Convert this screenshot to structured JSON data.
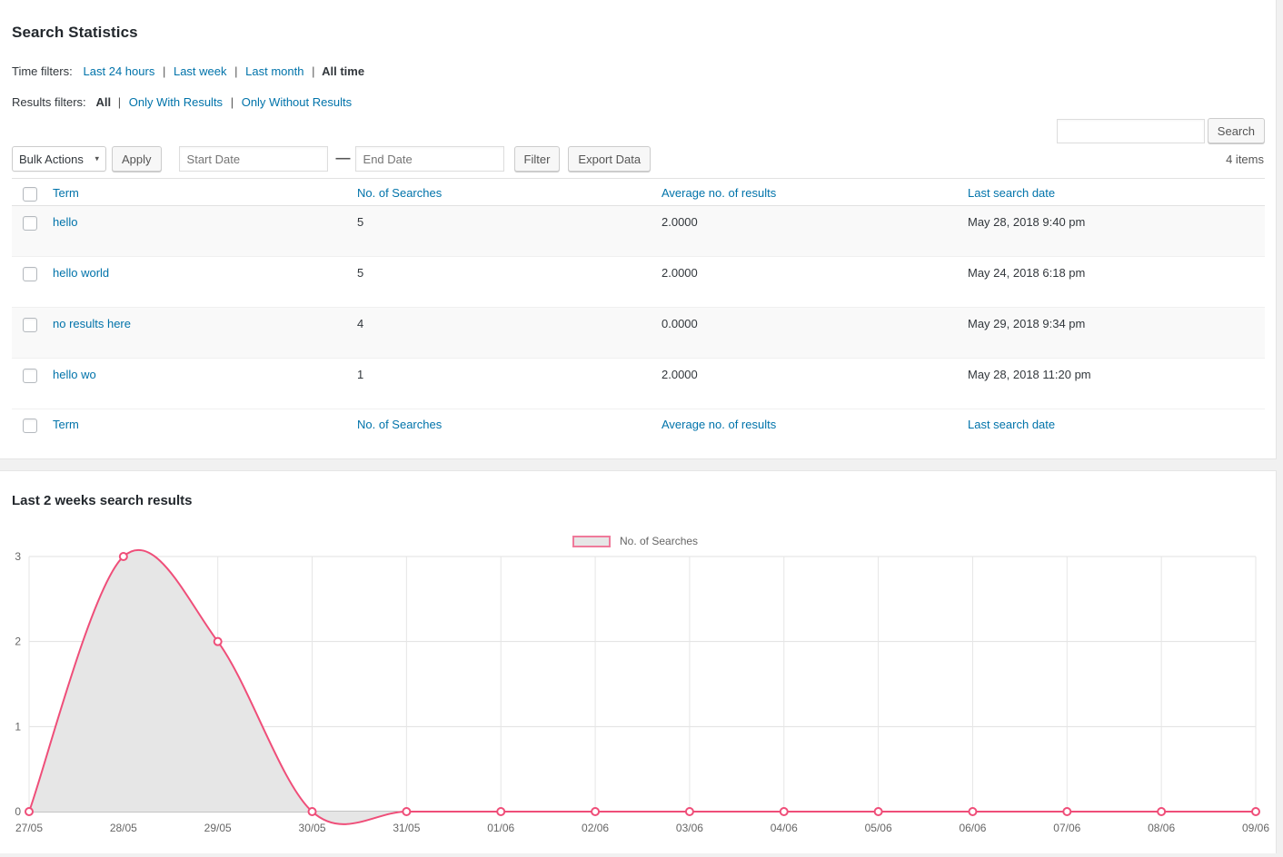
{
  "header": {
    "title": "Search Statistics"
  },
  "time_filters": {
    "label": "Time filters:",
    "items": [
      {
        "label": "Last 24 hours",
        "active": false
      },
      {
        "label": "Last week",
        "active": false
      },
      {
        "label": "Last month",
        "active": false
      },
      {
        "label": "All time",
        "active": true
      }
    ]
  },
  "results_filters": {
    "label": "Results filters:",
    "items": [
      {
        "label": "All",
        "active": true
      },
      {
        "label": "Only With Results",
        "active": false
      },
      {
        "label": "Only Without Results",
        "active": false
      }
    ]
  },
  "search": {
    "value": "",
    "placeholder": "",
    "button_label": "Search"
  },
  "items_count": "4 items",
  "toolbar": {
    "bulk_actions_label": "Bulk Actions",
    "bulk_actions_caret": "▾",
    "apply_label": "Apply",
    "start_date_placeholder": "Start Date",
    "start_date_value": "",
    "date_separator": "—",
    "end_date_placeholder": "End Date",
    "end_date_value": "",
    "filter_label": "Filter",
    "export_label": "Export Data"
  },
  "table": {
    "columns": [
      "Term",
      "No. of Searches",
      "Average no. of results",
      "Last search date"
    ],
    "rows": [
      {
        "term": "hello",
        "searches": "5",
        "average": "2.0000",
        "last_date": "May 28, 2018 9:40 pm"
      },
      {
        "term": "hello world",
        "searches": "5",
        "average": "2.0000",
        "last_date": "May 24, 2018 6:18 pm"
      },
      {
        "term": "no results here",
        "searches": "4",
        "average": "0.0000",
        "last_date": "May 29, 2018 9:34 pm"
      },
      {
        "term": "hello wo",
        "searches": "1",
        "average": "2.0000",
        "last_date": "May 28, 2018 11:20 pm"
      }
    ]
  },
  "chart_panel": {
    "title": "Last 2 weeks search results"
  },
  "chart_data": {
    "type": "area",
    "title": "Last 2 weeks search results",
    "xlabel": "",
    "ylabel": "",
    "categories": [
      "27/05",
      "28/05",
      "29/05",
      "30/05",
      "31/05",
      "01/06",
      "02/06",
      "03/06",
      "04/06",
      "05/06",
      "06/06",
      "07/06",
      "08/06",
      "09/06"
    ],
    "series": [
      {
        "name": "No. of Searches",
        "values": [
          0,
          3,
          2,
          0,
          0,
          0,
          0,
          0,
          0,
          0,
          0,
          0,
          0,
          0
        ]
      }
    ],
    "legend": [
      "No. of Searches"
    ],
    "legend_position": "top-center",
    "ylim": [
      0,
      3
    ],
    "yticks": [
      0,
      1,
      2,
      3
    ],
    "grid": true,
    "line_color": "#ef4e79",
    "fill_color": "#e6e6e6",
    "point_color": "#ffffff",
    "smooth": true
  },
  "colors": {
    "link": "#0073aa",
    "text": "#32373c",
    "panel_bg": "#ffffff",
    "page_bg": "#f1f1f1",
    "row_alt": "#f9f9f9",
    "accent_pink": "#ef4e79"
  }
}
